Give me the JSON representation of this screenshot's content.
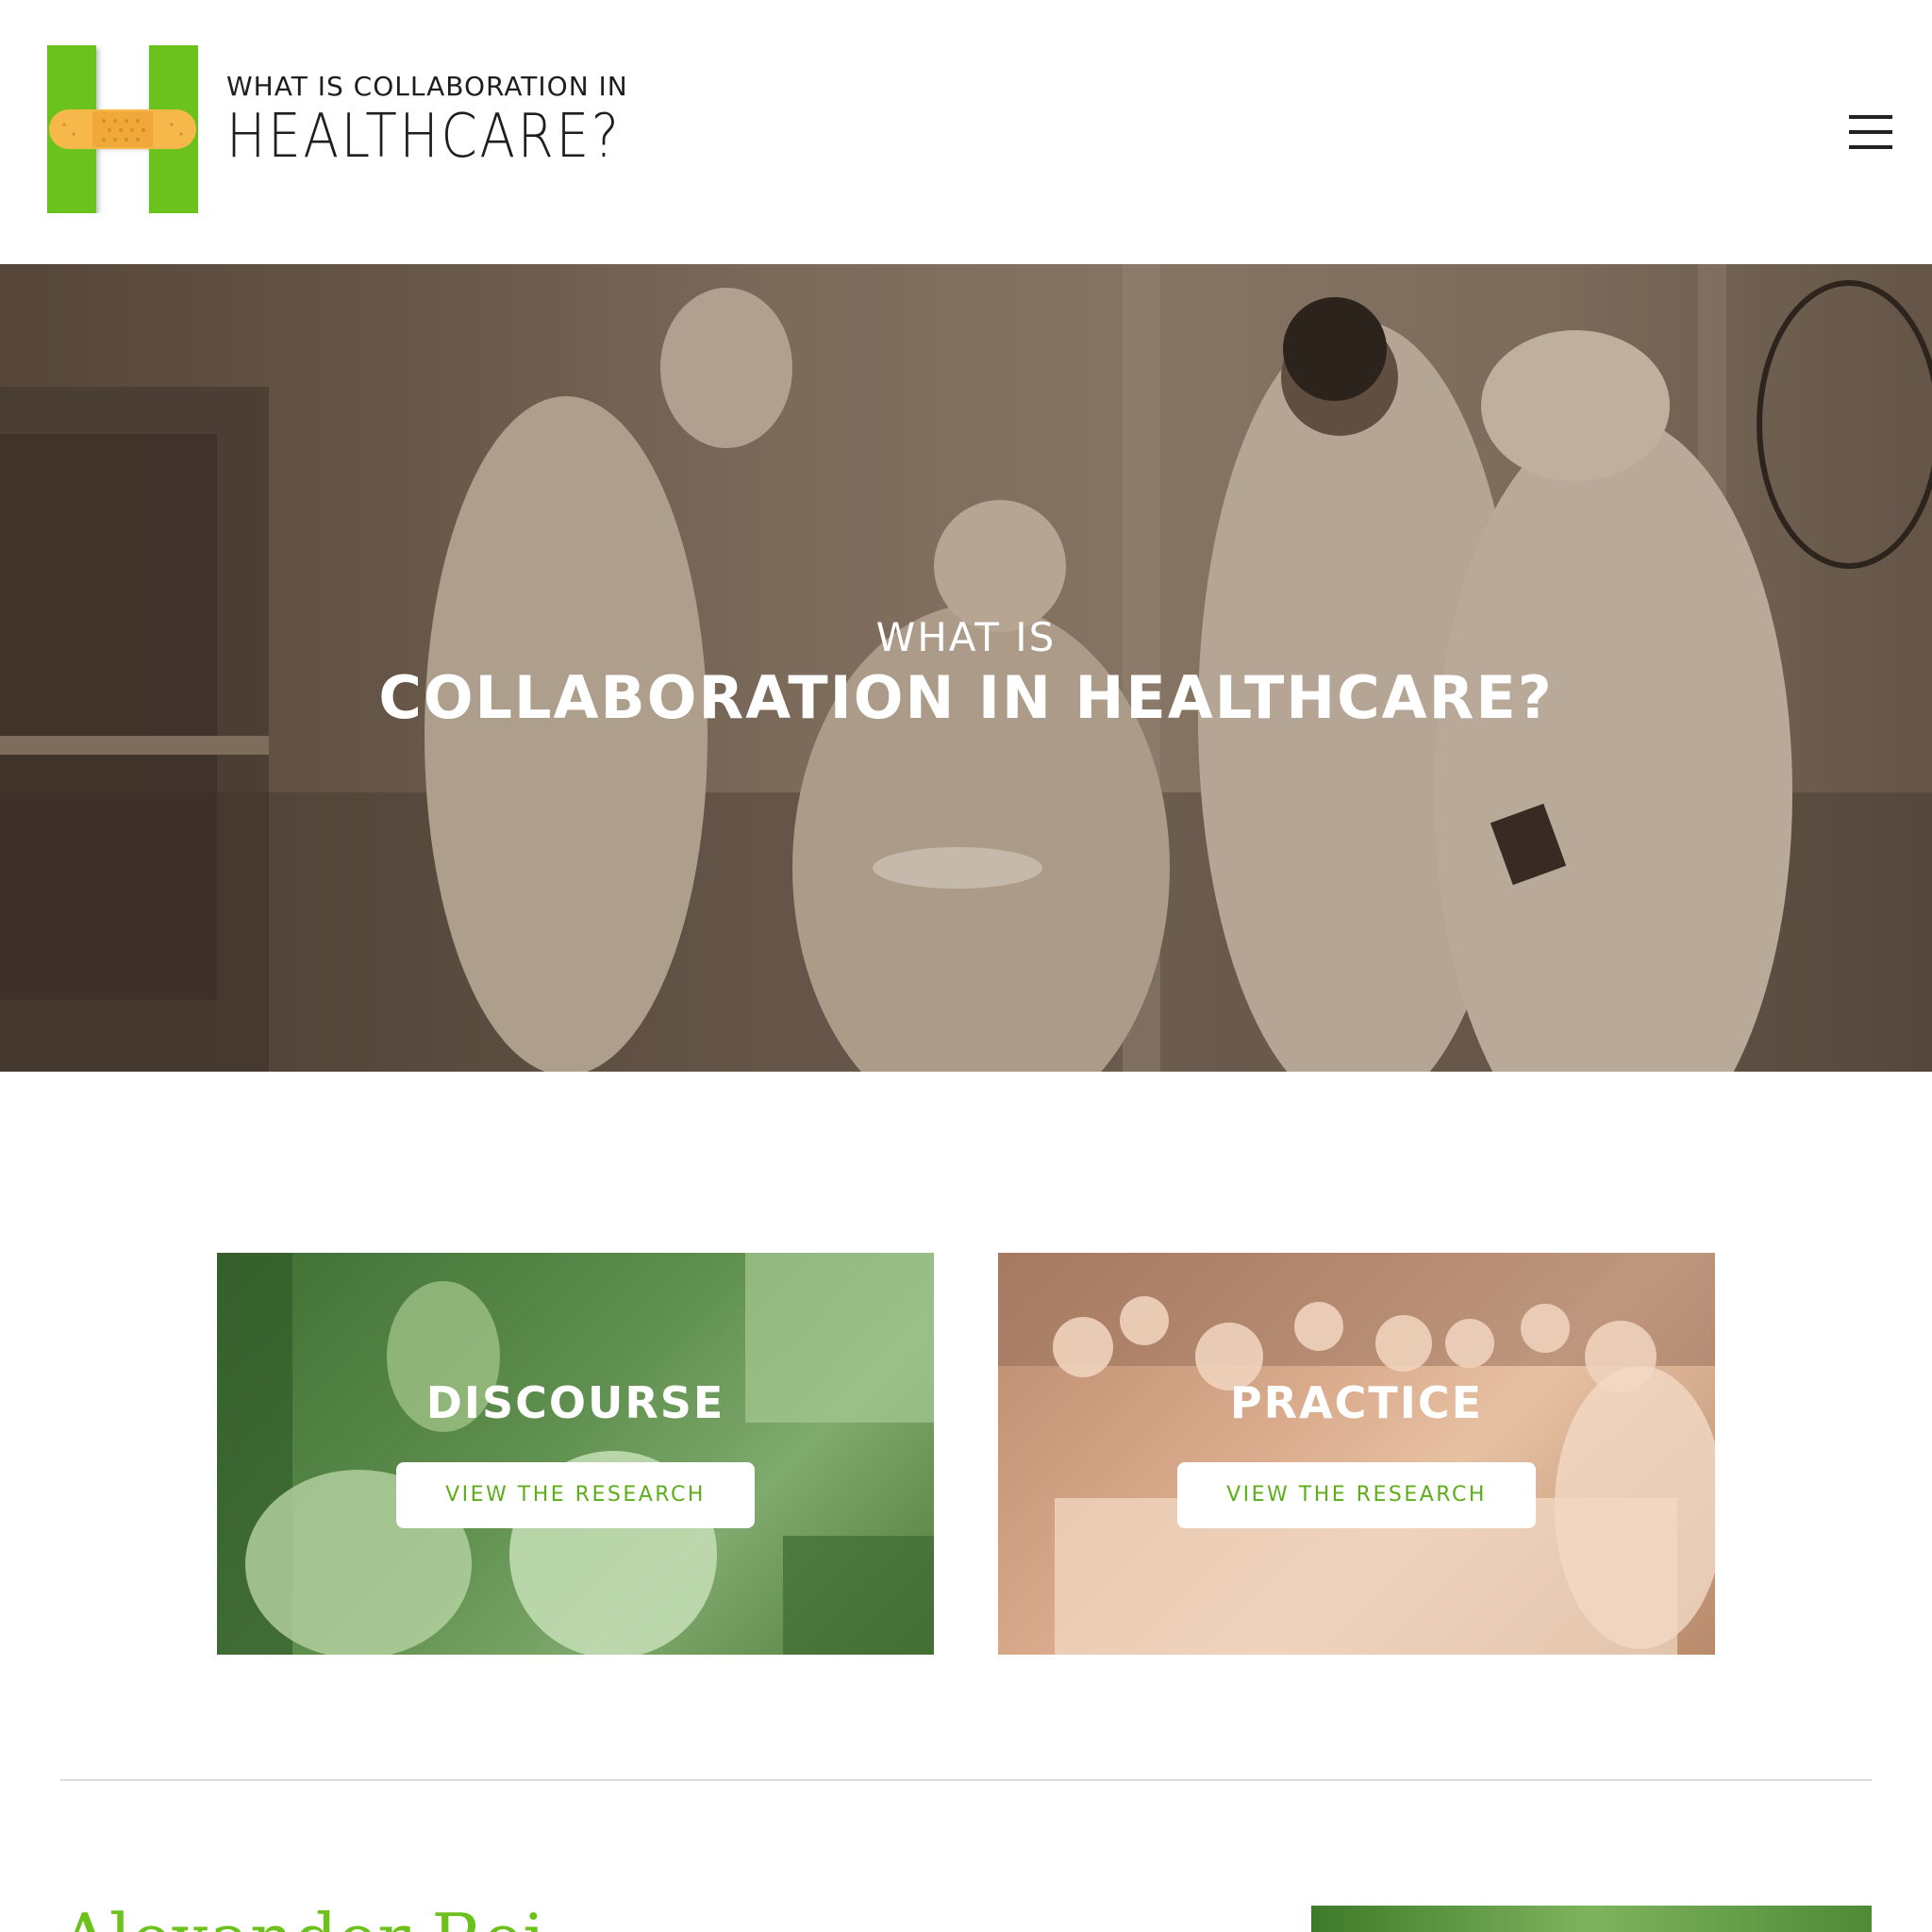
{
  "header": {
    "logo_small": "WHAT IS COLLABORATION IN",
    "logo_big": "HEALTHCARE?",
    "menu_icon": "hamburger-menu-icon"
  },
  "hero": {
    "title_small": "WHAT IS",
    "title_big": "COLLABORATION IN HEALTHCARE?"
  },
  "cards": [
    {
      "title": "DISCOURSE",
      "button_label": "VIEW THE RESEARCH"
    },
    {
      "title": "PRACTICE",
      "button_label": "VIEW THE RESEARCH"
    }
  ],
  "section": {
    "heading": "Alexander Rei"
  },
  "colors": {
    "brand_green": "#6cc21a",
    "bandage_orange": "#f6b84a",
    "button_text_green": "#5dae1a"
  }
}
